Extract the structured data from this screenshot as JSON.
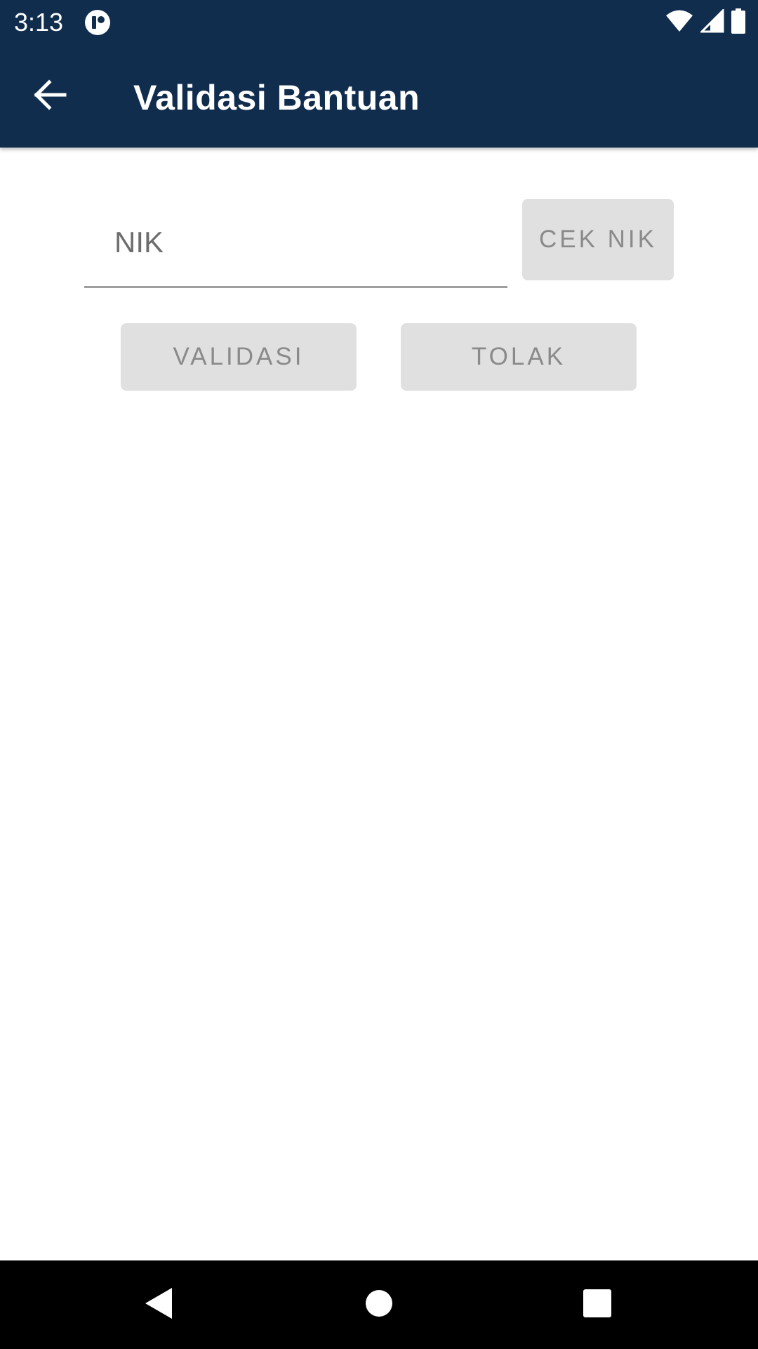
{
  "status_bar": {
    "time": "3:13",
    "app_icon": "notification-app-icon",
    "icons": [
      "wifi-icon",
      "cell-signal-icon",
      "battery-icon"
    ]
  },
  "app_bar": {
    "title": "Validasi Bantuan",
    "back_icon": "arrow-left-icon",
    "background_color": "#112d4e"
  },
  "form": {
    "nik_placeholder": "NIK",
    "nik_value": "",
    "cek_button_label": "CEK NIK",
    "validasi_button_label": "VALIDASI",
    "tolak_button_label": "TOLAK"
  },
  "nav_bar": {
    "icons": [
      "nav-back-icon",
      "nav-home-icon",
      "nav-recents-icon"
    ]
  }
}
